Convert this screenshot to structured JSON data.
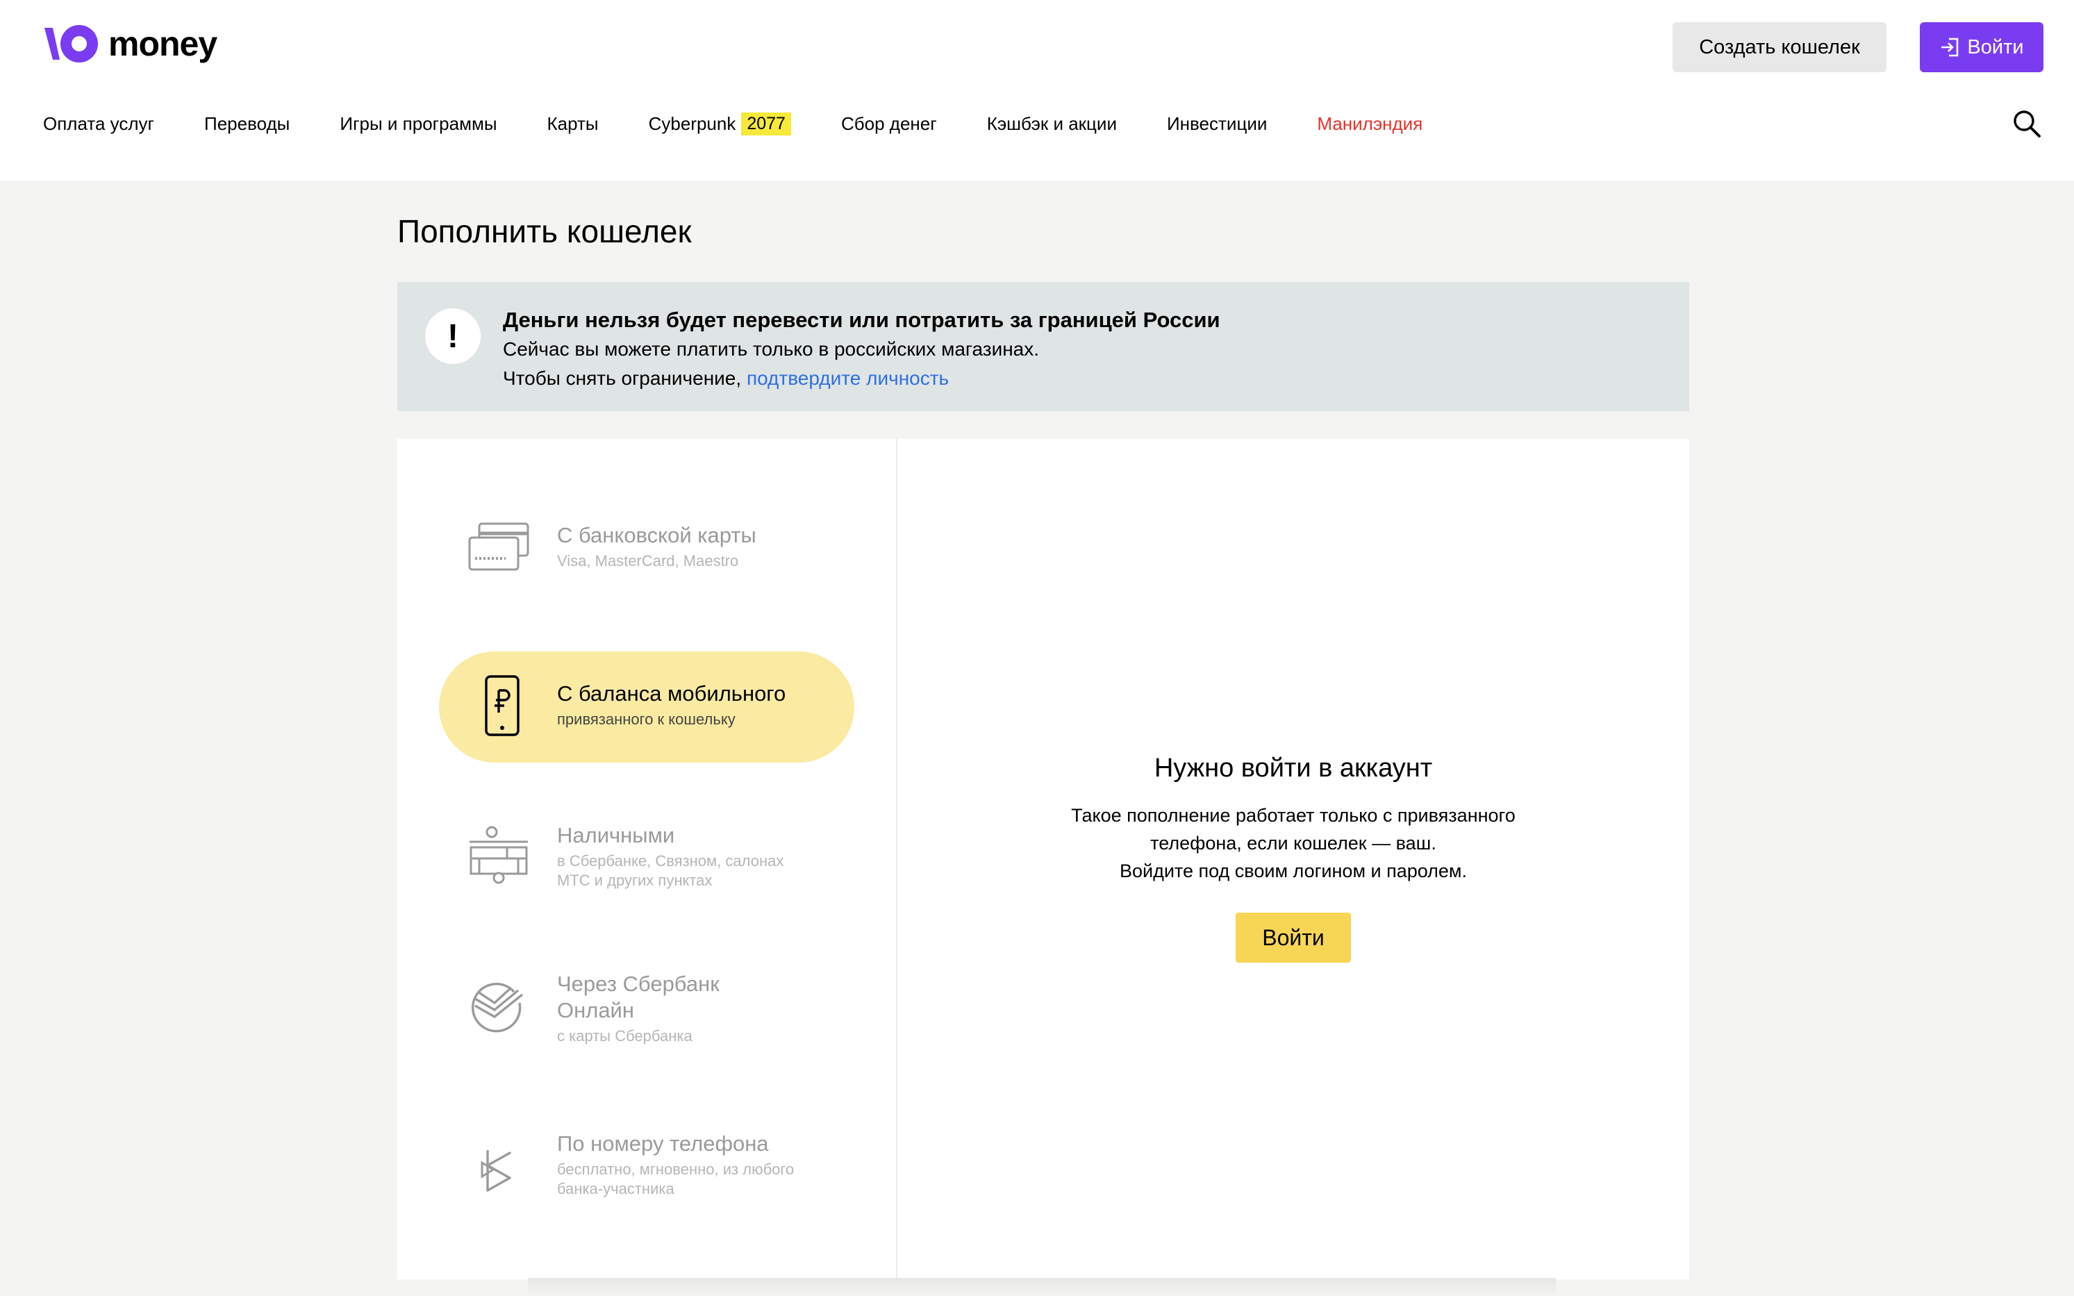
{
  "header": {
    "logo_text": "money",
    "create_wallet_label": "Создать кошелек",
    "login_label": "Войти",
    "brand_color": "#7a3cf0"
  },
  "nav": {
    "items": [
      {
        "label": "Оплата услуг"
      },
      {
        "label": "Переводы"
      },
      {
        "label": "Игры и программы"
      },
      {
        "label": "Карты"
      },
      {
        "label": "Cyberpunk",
        "badge": "2077"
      },
      {
        "label": "Сбор денег"
      },
      {
        "label": "Кэшбэк и акции"
      },
      {
        "label": "Инвестиции"
      },
      {
        "label": "Манилэндия",
        "accent_color": "#e0342c"
      }
    ]
  },
  "page": {
    "title": "Пополнить кошелек"
  },
  "alert": {
    "icon": "!",
    "title": "Деньги нельзя будет перевести или потратить за границей России",
    "line1": "Сейчас вы можете платить только в российских магазинах.",
    "line2_prefix": "Чтобы снять ограничение, ",
    "line2_link": "подтвердите личность"
  },
  "methods": [
    {
      "title": "С банковской карты",
      "subtitle": "Visa, MasterCard, Maestro",
      "icon": "bank-card-icon",
      "active": false
    },
    {
      "title": "С баланса мобильного",
      "subtitle": "привязанного к кошельку",
      "icon": "mobile-ruble-icon",
      "active": true
    },
    {
      "title": "Наличными",
      "subtitle_lines": [
        "в Сбербанке, Связном, салонах",
        "МТС и других пунктах"
      ],
      "icon": "cash-terminal-icon",
      "active": false
    },
    {
      "title_lines": [
        "Через Сбербанк",
        "Онлайн"
      ],
      "subtitle": "с карты Сбербанка",
      "icon": "sberbank-icon",
      "active": false
    },
    {
      "title": "По номеру телефона",
      "subtitle_lines": [
        "бесплатно, мгновенно, из любого",
        "банка-участника"
      ],
      "icon": "sbp-icon",
      "active": false
    }
  ],
  "login_prompt": {
    "title": "Нужно войти в аккаунт",
    "line1": "Такое пополнение работает только с привязанного",
    "line2": "телефона, если кошелек — ваш.",
    "line3": "Войдите под своим логином и паролем.",
    "button_label": "Войти"
  },
  "colors": {
    "active_method_bg": "#fbeaa2",
    "login_button_bg": "#f7d655",
    "alert_bg": "#dfe4e5",
    "link_color": "#2f6fe0",
    "nav_badge_bg": "#f6e93a"
  }
}
